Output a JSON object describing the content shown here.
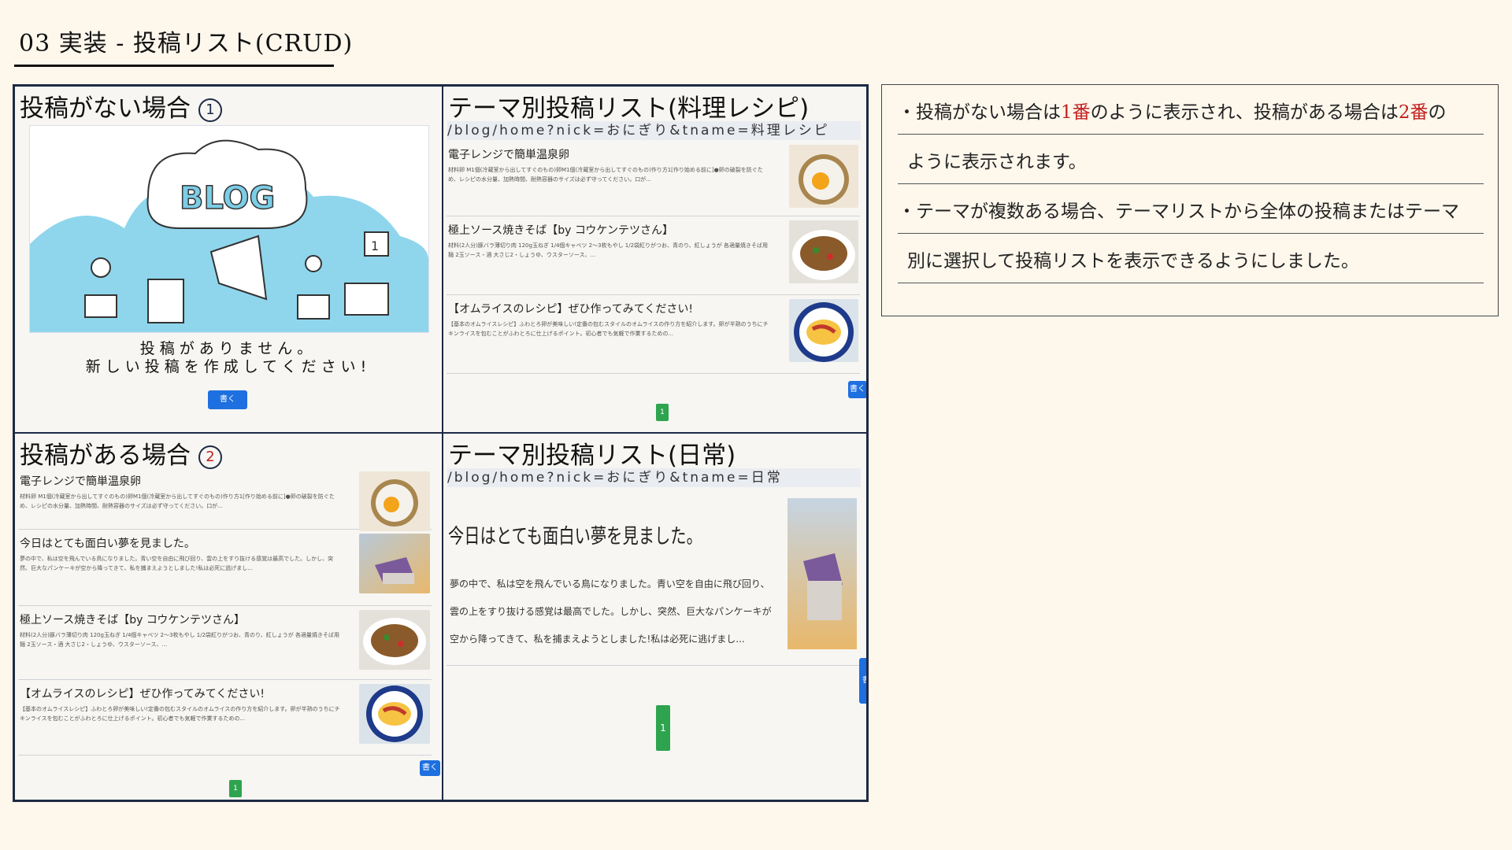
{
  "slide": {
    "title": "03 実装 - 投稿リスト(CRUD)"
  },
  "q1": {
    "heading": "投稿がない場合",
    "badge": "1",
    "empty_line1": "投稿がありません。",
    "empty_line2": "新しい投稿を作成してください!",
    "write_button": "書く"
  },
  "q2": {
    "heading": "テーマ別投稿リスト(料理レシピ)",
    "url": "/blog/home?nick=おにぎり&tname=料理レシピ",
    "items": [
      {
        "title": "電子レンジで簡単温泉卵",
        "desc": "材料卵 M1個(冷蔵室から出してすぐのもの)卵M1個(冷蔵室から出してすぐのもの)作り方1[作り始める前に]●卵の破裂を防ぐため、レシピの水分量、加熱時間、耐熱容器のサイズは必ず守ってください。口が..."
      },
      {
        "title": "極上ソース焼きそば【by コウケンテツさん】",
        "desc": "材料(2人分)豚バラ薄切り肉 120g玉ねぎ 1/4個キャベツ 2〜3枚もやし 1/2袋紅りがつお、青のり、紅しょうが 各適量焼きそば用麺 2玉ソース・酒 大さじ2・しょうゆ、ウスターソース、..."
      },
      {
        "title": "【オムライスのレシピ】ぜひ作ってみてください!",
        "desc": "【基本のオムライスレシピ】ふわとろ卵が美味しい!定番の包むスタイルのオムライスの作り方を紹介します。卵が半熟のうちにチキンライスを包むことがふわとろに仕上げるポイント。初心者でも気軽で作業するための..."
      }
    ],
    "write_button": "書く",
    "page": "1"
  },
  "q3": {
    "heading": "投稿がある場合",
    "badge": "2",
    "items": [
      {
        "title": "電子レンジで簡単温泉卵",
        "desc": "材料卵 M1個(冷蔵室から出してすぐのもの)卵M1個(冷蔵室から出してすぐのもの)作り方1[作り始める前に]●卵の破裂を防ぐため、レシピの水分量、加熱時間、耐熱容器のサイズは必ず守ってください。口が..."
      },
      {
        "title": "今日はとても面白い夢を見ました。",
        "desc": "夢の中で、私は空を飛んでいる鳥になりました。青い空を自由に飛び回り、雲の上をすり抜ける感覚は最高でした。しかし、突然、巨大なパンケーキが空から降ってきて、私を捕まえようとしました!私は必死に逃げまし..."
      },
      {
        "title": "極上ソース焼きそば【by コウケンテツさん】",
        "desc": "材料(2人分)豚バラ薄切り肉 120g玉ねぎ 1/4個キャベツ 2〜3枚もやし 1/2袋紅りがつお、青のり、紅しょうが 各適量焼きそば用麺 2玉ソース・酒 大さじ2・しょうゆ、ウスターソース、..."
      },
      {
        "title": "【オムライスのレシピ】ぜひ作ってみてください!",
        "desc": "【基本のオムライスレシピ】ふわとろ卵が美味しい!定番の包むスタイルのオムライスの作り方を紹介します。卵が半熟のうちにチキンライスを包むことがふわとろに仕上げるポイント。初心者でも気軽で作業するための..."
      }
    ],
    "write_button": "書く",
    "page": "1"
  },
  "q4": {
    "heading": "テーマ別投稿リスト(日常)",
    "url": "/blog/home?nick=おにぎり&tname=日常",
    "item": {
      "title": "今日はとても面白い夢を見ました。",
      "desc": "夢の中で、私は空を飛んでいる鳥になりました。青い空を自由に飛び回り、雲の上をすり抜ける感覚は最高でした。しかし、突然、巨大なパンケーキが空から降ってきて、私を捕まえようとしました!私は必死に逃げまし..."
    },
    "write_button": "書く",
    "page": "1"
  },
  "note": {
    "l1a": "・投稿がない場合は",
    "l1b": "1番",
    "l1c": "のように表示され、投稿がある場合は",
    "l1d": "2番",
    "l1e": "の",
    "l2": "ように表示されます。",
    "l3": "・テーマが複数ある場合、テーマリストから全体の投稿またはテーマ",
    "l4": "別に選択して投稿リストを表示できるようにしました。"
  },
  "colors": {
    "accent_blue": "#1e6fe0",
    "accent_green": "#2ea44f",
    "highlight_red": "#c2211f",
    "frame": "#1d2a44"
  }
}
